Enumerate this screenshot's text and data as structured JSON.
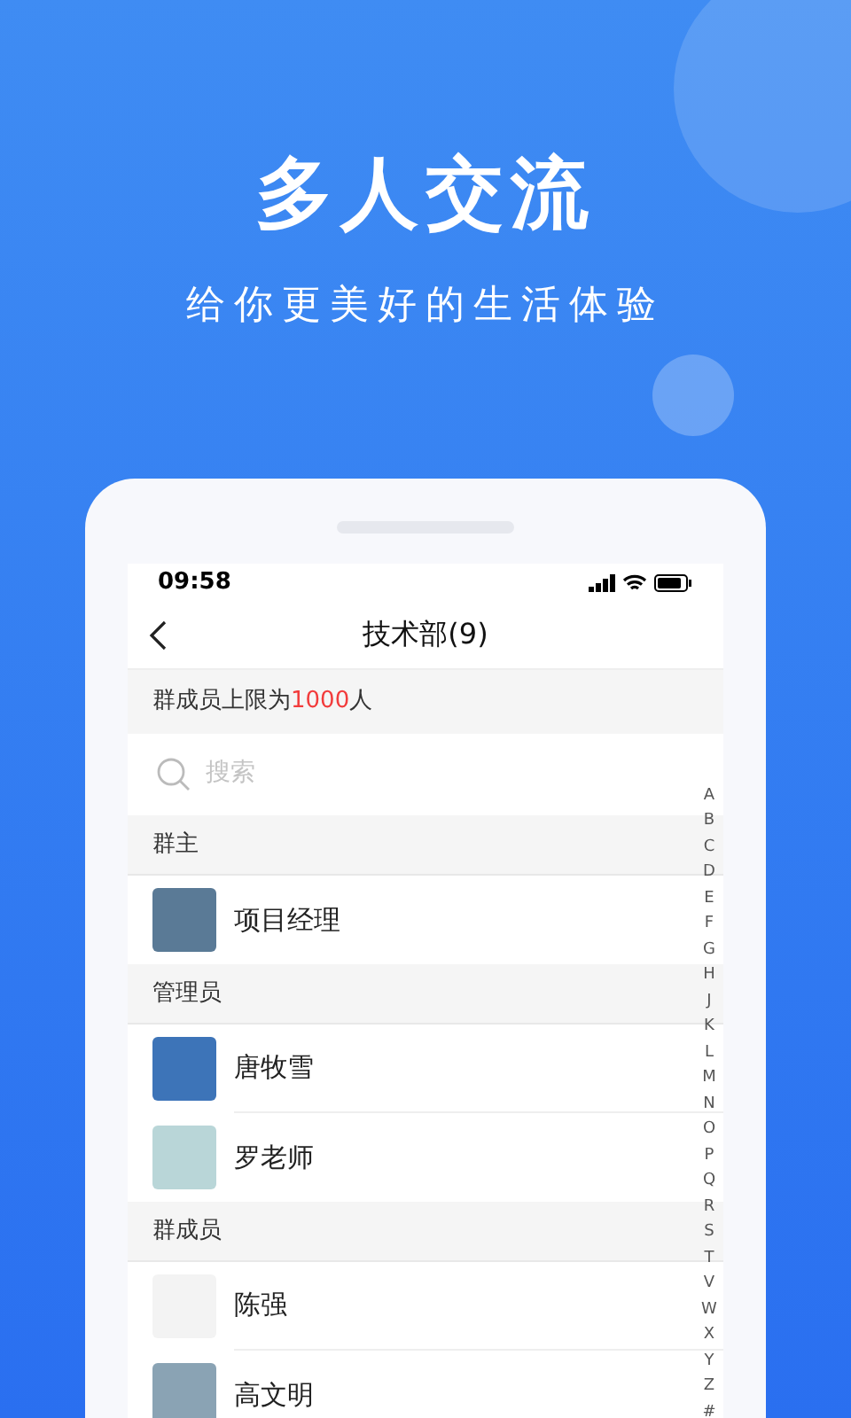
{
  "headline": "多人交流",
  "subtitle": "给你更美好的生活体验",
  "phone": {
    "status_bar": {
      "time": "09:58"
    },
    "nav": {
      "title": "技术部(9)"
    },
    "limit_notice": {
      "before": "群成员上限为",
      "count": "1000",
      "after": "人"
    },
    "search": {
      "placeholder": "搜索"
    },
    "sections": [
      {
        "title": "群主",
        "members": [
          {
            "name": "项目经理"
          }
        ]
      },
      {
        "title": "管理员",
        "members": [
          {
            "name": "唐牧雪"
          },
          {
            "name": "罗老师"
          }
        ]
      },
      {
        "title": "群成员",
        "members": [
          {
            "name": "陈强"
          },
          {
            "name": "高文明"
          }
        ]
      }
    ],
    "index_letters": [
      "A",
      "B",
      "C",
      "D",
      "E",
      "F",
      "G",
      "H",
      "J",
      "K",
      "L",
      "M",
      "N",
      "O",
      "P",
      "Q",
      "R",
      "S",
      "T",
      "V",
      "W",
      "X",
      "Y",
      "Z",
      "#"
    ]
  }
}
